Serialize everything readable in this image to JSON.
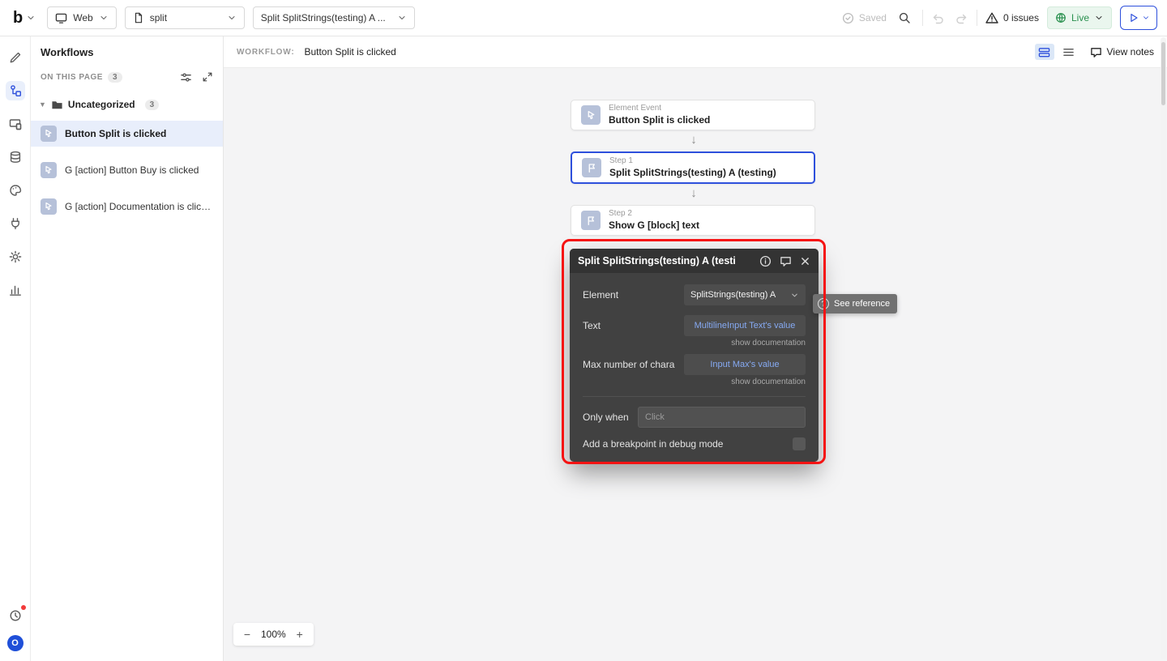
{
  "colors": {
    "accent_blue": "#2e50dc",
    "live_green": "#2b9150",
    "annotation_red": "#f51313",
    "link_blue": "#86aaf3",
    "popup_bg": "#414141",
    "canvas_bg": "#f4f4f5",
    "selected_item_bg": "#e8eefb"
  },
  "topbar": {
    "logo": "b",
    "platform": "Web",
    "page": "split",
    "workflow": "Split SplitStrings(testing) A ...",
    "saved": "Saved",
    "issues": "0 issues",
    "live": "Live"
  },
  "rail": {
    "avatar": "O"
  },
  "workflows": {
    "title": "Workflows",
    "section_label": "ON THIS PAGE",
    "section_count": "3",
    "folder": {
      "name": "Uncategorized",
      "count": "3"
    },
    "items": [
      {
        "label": "Button Split is clicked"
      },
      {
        "label": "G [action] Button Buy is clicked"
      },
      {
        "label": "G [action] Documentation is click..."
      }
    ]
  },
  "canvas_header": {
    "label": "WORKFLOW:",
    "name": "Button Split is clicked",
    "view_notes": "View notes"
  },
  "canvas": {
    "cards": [
      {
        "kind": "Element Event",
        "title": "Button Split is clicked"
      },
      {
        "kind": "Step 1",
        "title": "Split SplitStrings(testing) A (testing)"
      },
      {
        "kind": "Step 2",
        "title": "Show G [block] text"
      }
    ],
    "arrow": "↓",
    "zoom": {
      "minus": "−",
      "level": "100%",
      "plus": "+"
    }
  },
  "popup": {
    "title": "Split SplitStrings(testing) A (testi",
    "element_label": "Element",
    "element_value": "SplitStrings(testing) A",
    "text_label": "Text",
    "text_value": "MultilineInput Text's value",
    "max_label": "Max number of chara",
    "max_value": "Input Max's value",
    "doc_link": "show documentation",
    "only_when_label": "Only when",
    "only_when_placeholder": "Click",
    "breakpoint_label": "Add a breakpoint in debug mode"
  },
  "tooltip": {
    "icon": "?",
    "label": "See reference"
  }
}
